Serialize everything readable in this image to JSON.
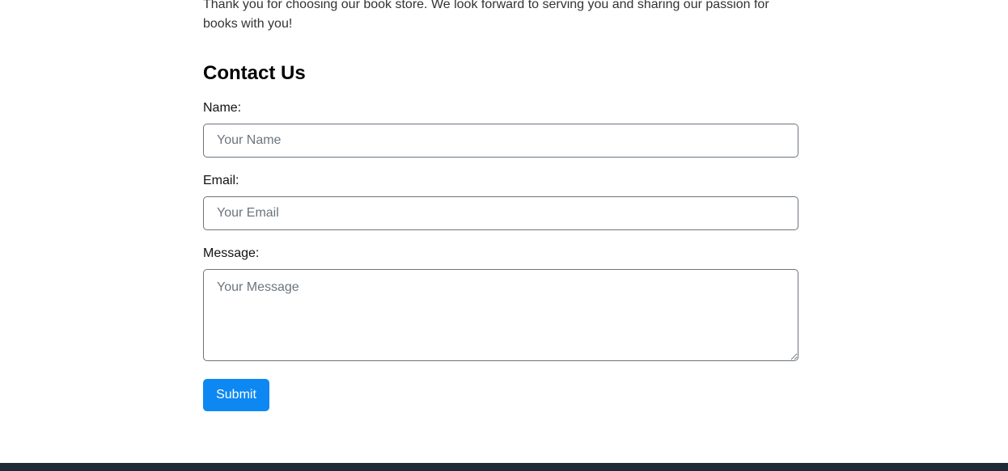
{
  "intro": {
    "text": "Thank you for choosing our book store. We look forward to serving you and sharing our passion for books with you!"
  },
  "contact": {
    "heading": "Contact Us",
    "name_label": "Name:",
    "name_placeholder": "Your Name",
    "name_value": "",
    "email_label": "Email:",
    "email_placeholder": "Your Email",
    "email_value": "",
    "message_label": "Message:",
    "message_placeholder": "Your Message",
    "message_value": "",
    "submit_label": "Submit"
  },
  "colors": {
    "button": "#0d88f2",
    "footer": "#1e2a36",
    "border": "#6c757d"
  }
}
